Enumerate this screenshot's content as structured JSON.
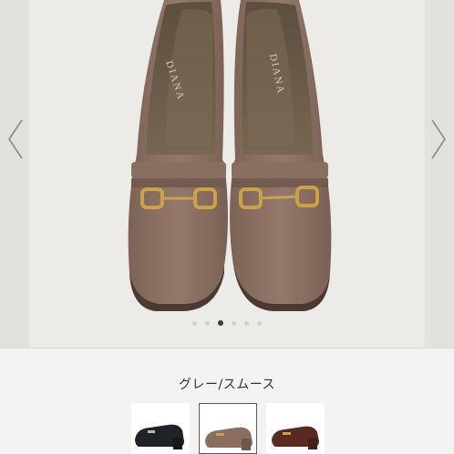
{
  "gallery": {
    "brand_mark": "DIANA",
    "current_index": 3,
    "total_images": 6
  },
  "variant": {
    "selected_label": "グレー/スムース"
  },
  "thumbnails": [
    {
      "name": "black",
      "color": "#1f2226",
      "selected": false
    },
    {
      "name": "grey-smooth",
      "color": "#8a6e60",
      "selected": true
    },
    {
      "name": "brown",
      "color": "#5a2a22",
      "selected": false
    }
  ],
  "colors": {
    "shoe_upper": "#8b7063",
    "shoe_lining": "#6b5a45",
    "hardware_gold": "#c9a24a",
    "background": "#ecebe8"
  },
  "icons": {
    "prev": "chevron-left-icon",
    "next": "chevron-right-icon"
  }
}
